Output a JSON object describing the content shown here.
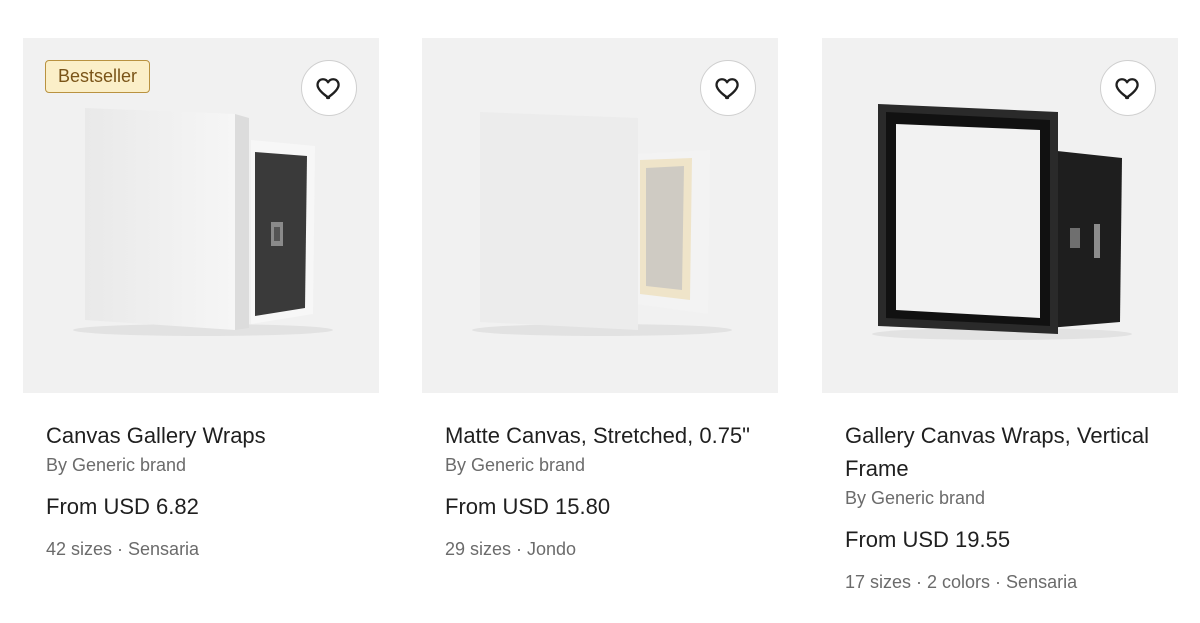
{
  "products": [
    {
      "badge": "Bestseller",
      "title": "Canvas Gallery Wraps",
      "brand": "By Generic brand",
      "price": "From USD 6.82",
      "meta": "42 sizes · Sensaria",
      "image": "white-gallery-wrap-canvas"
    },
    {
      "title": "Matte Canvas, Stretched, 0.75\"",
      "brand": "By Generic brand",
      "price": "From USD 15.80",
      "meta": "29 sizes · Jondo",
      "image": "matte-stretched-canvas"
    },
    {
      "title": "Gallery Canvas Wraps, Vertical Frame",
      "brand": "By Generic brand",
      "price": "From USD 19.55",
      "meta": "17 sizes · 2 colors · Sensaria",
      "image": "black-framed-canvas"
    }
  ],
  "icons": {
    "favorite": "heart-outline-icon"
  },
  "colors": {
    "image_bg": "#f1f1f1",
    "badge_bg": "#fbefc8",
    "badge_border": "#b99240",
    "muted_text": "#6b6b6b"
  }
}
